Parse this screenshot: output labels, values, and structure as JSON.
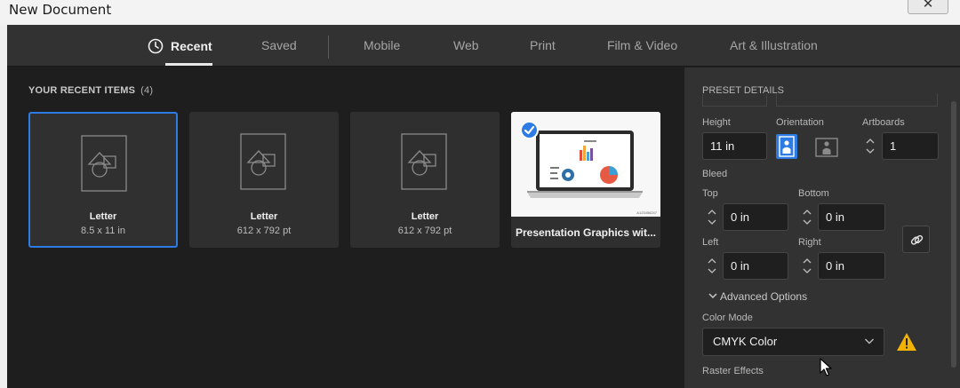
{
  "window": {
    "title": "New Document",
    "close_glyph": "✕"
  },
  "tabs": [
    "Recent",
    "Saved",
    "Mobile",
    "Web",
    "Print",
    "Film & Video",
    "Art & Illustration"
  ],
  "recent": {
    "heading": "YOUR RECENT ITEMS",
    "count": "(4)",
    "items": [
      {
        "name": "Letter",
        "dims": "8.5 x 11 in"
      },
      {
        "name": "Letter",
        "dims": "612 x 792 pt"
      },
      {
        "name": "Letter",
        "dims": "612 x 792 pt"
      },
      {
        "name": "Presentation Graphics wit..."
      }
    ],
    "thumb_code": "A123456247"
  },
  "preset": {
    "heading": "PRESET DETAILS",
    "height_label": "Height",
    "height_value": "11 in",
    "orientation_label": "Orientation",
    "artboards_label": "Artboards",
    "artboards_value": "1",
    "bleed_label": "Bleed",
    "top_label": "Top",
    "top_value": "0 in",
    "bottom_label": "Bottom",
    "bottom_value": "0 in",
    "left_label": "Left",
    "left_value": "0 in",
    "right_label": "Right",
    "right_value": "0 in",
    "advanced_label": "Advanced Options",
    "color_mode_label": "Color Mode",
    "color_mode_value": "CMYK Color",
    "raster_label": "Raster Effects"
  },
  "colors": {
    "accent": "#2d7be5",
    "warning": "#f2b300",
    "panel": "#323232",
    "canvas": "#1e1e1e"
  },
  "icons": [
    "clock-icon",
    "document-icon",
    "checkmark-icon",
    "portrait-icon",
    "landscape-icon",
    "link-icon",
    "chevron-down-icon",
    "warning-icon",
    "cursor-icon"
  ]
}
